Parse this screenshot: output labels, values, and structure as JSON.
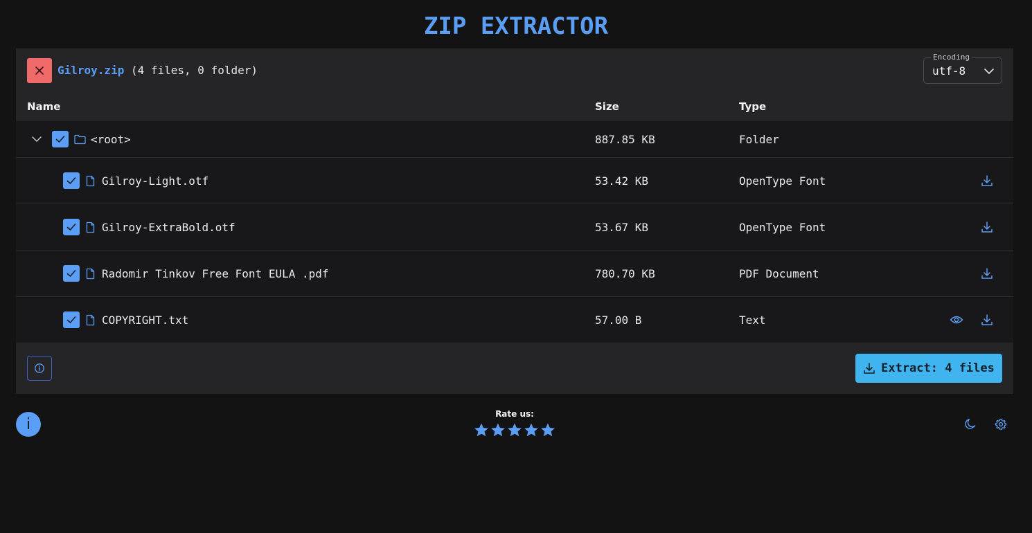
{
  "app": {
    "title": "ZIP EXTRACTOR"
  },
  "archive": {
    "name": "Gilroy.zip",
    "summary": "(4 files, 0 folder)"
  },
  "encoding": {
    "label": "Encoding",
    "value": "utf-8"
  },
  "table": {
    "columns": {
      "name": "Name",
      "size": "Size",
      "type": "Type"
    },
    "root": {
      "name": "<root>",
      "size": "887.85 KB",
      "type": "Folder",
      "checked": true,
      "expanded": true
    },
    "files": [
      {
        "name": "Gilroy-Light.otf",
        "size": "53.42 KB",
        "type": "OpenType Font",
        "checked": true,
        "preview": false
      },
      {
        "name": "Gilroy-ExtraBold.otf",
        "size": "53.67 KB",
        "type": "OpenType Font",
        "checked": true,
        "preview": false
      },
      {
        "name": "Radomir Tinkov Free Font EULA .pdf",
        "size": "780.70 KB",
        "type": "PDF Document",
        "checked": true,
        "preview": false
      },
      {
        "name": "COPYRIGHT.txt",
        "size": "57.00 B",
        "type": "Text",
        "checked": true,
        "preview": true
      }
    ]
  },
  "footer": {
    "extract_label": "Extract: 4 files"
  },
  "fab": {
    "label": "i"
  },
  "rating": {
    "label": "Rate us:",
    "stars": 5
  },
  "colors": {
    "accent": "#5b9ef5",
    "danger": "#f16a6a",
    "extract": "#3fb4ef",
    "background": "#131314",
    "panel": "#252528"
  },
  "icons": [
    "close-icon",
    "chevron-down-icon",
    "folder-icon",
    "file-icon",
    "check-icon",
    "download-icon",
    "eye-icon",
    "info-icon",
    "star-icon",
    "moon-icon",
    "gear-icon"
  ]
}
